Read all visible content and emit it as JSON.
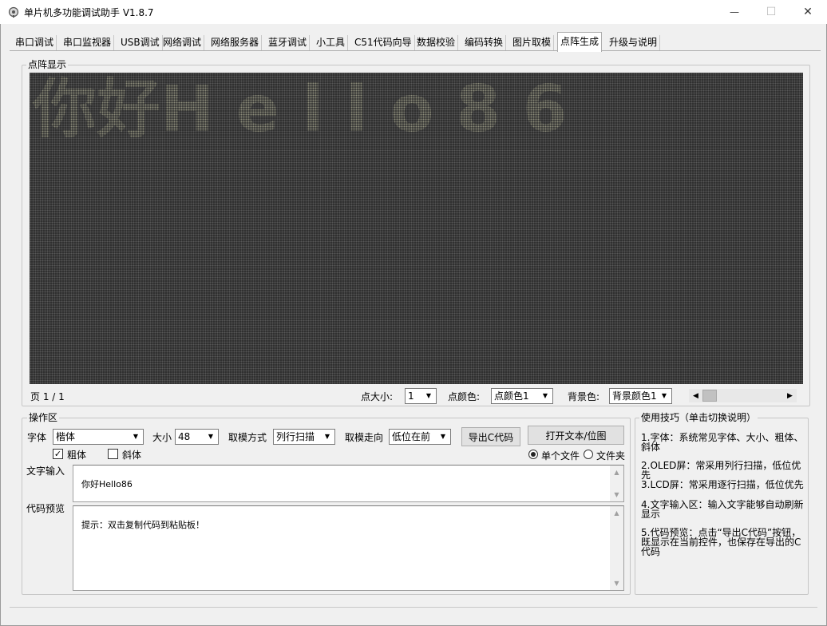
{
  "window": {
    "title": "单片机多功能调试助手 V1.8.7",
    "minimize_glyph": "—",
    "maximize_glyph": "☐",
    "close_glyph": "✕"
  },
  "tabs": [
    {
      "label": "串口调试"
    },
    {
      "label": "串口监视器"
    },
    {
      "label": "USB调试"
    },
    {
      "label": "网络调试"
    },
    {
      "label": "网络服务器"
    },
    {
      "label": "蓝牙调试"
    },
    {
      "label": "小工具"
    },
    {
      "label": "C51代码向导"
    },
    {
      "label": "数据校验"
    },
    {
      "label": "编码转换"
    },
    {
      "label": "图片取模"
    },
    {
      "label": "点阵生成",
      "active": true
    },
    {
      "label": "升级与说明"
    }
  ],
  "matrix_panel": {
    "legend": "点阵显示",
    "display_text": "你好H e l l o 8 6",
    "page_label": "页 1 / 1",
    "dot_size_label": "点大小:",
    "dot_size_value": "1",
    "dot_color_label": "点颜色:",
    "dot_color_value": "点颜色1",
    "bg_color_label": "背景色:",
    "bg_color_value": "背景颜色1",
    "colors": {
      "background": "#2f2f2f",
      "dot_on": "#8b8b7a",
      "dot_off": "#575757"
    }
  },
  "ops": {
    "legend": "操作区",
    "font_label": "字体",
    "font_value": "楷体",
    "size_label": "大小",
    "size_value": "48",
    "scan_label": "取模方式",
    "scan_value": "列行扫描",
    "dir_label": "取模走向",
    "dir_value": "低位在前",
    "export_button": "导出C代码",
    "open_button": "打开文本/位图",
    "bold_label": "粗体",
    "bold_checked": true,
    "italic_label": "斜体",
    "italic_checked": false,
    "single_file_label": "单个文件",
    "folder_label": "文件夹",
    "text_input_label": "文字输入",
    "text_input_value": "你好Hello86",
    "code_preview_label": "代码预览",
    "code_preview_value": "提示：双击复制代码到粘贴板！"
  },
  "tips": {
    "legend": "使用技巧（单击切换说明）",
    "items": [
      "1.字体：系统常见字体、大小、粗体、斜体",
      "2.OLED屏：常采用列行扫描，低位优先",
      "3.LCD屏：常采用逐行扫描，低位优先",
      "4.文字输入区：输入文字能够自动刷新显示",
      "5.代码预览：点击“导出C代码”按钮，既显示在当前控件，也保存在导出的C代码"
    ]
  }
}
